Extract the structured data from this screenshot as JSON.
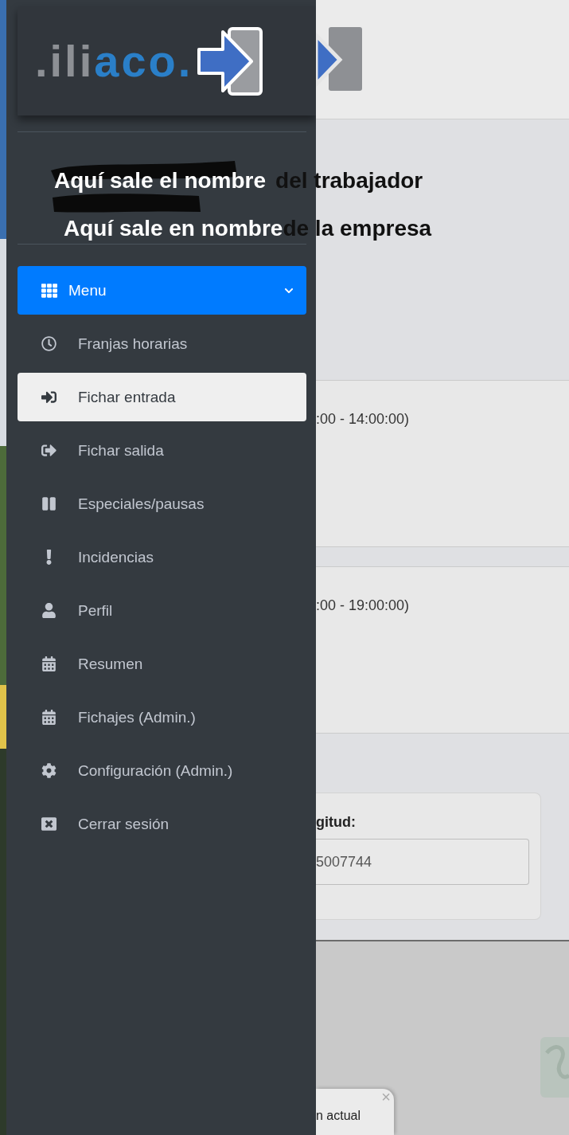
{
  "sidebar": {
    "logo": {
      "gray": ".ili",
      "blue": "aco."
    },
    "menu": {
      "label": "Menu",
      "expanded": true
    },
    "items": [
      {
        "label": "Franjas horarias",
        "selected": false
      },
      {
        "label": "Fichar entrada",
        "selected": true
      },
      {
        "label": "Fichar salida",
        "selected": false
      },
      {
        "label": "Especiales/pausas",
        "selected": false
      },
      {
        "label": "Incidencias",
        "selected": false
      },
      {
        "label": "Perfil",
        "selected": false
      },
      {
        "label": "Resumen",
        "selected": false
      },
      {
        "label": "Fichajes (Admin.)",
        "selected": false
      },
      {
        "label": "Configuración (Admin.)",
        "selected": false
      },
      {
        "label": "Cerrar sesión",
        "selected": false
      }
    ]
  },
  "annotations": [
    {
      "left": "Aquí sale el nombre",
      "right": "del trabajador"
    },
    {
      "left": "Aquí sale en nombre",
      "right": "de la empresa"
    }
  ],
  "slots": [
    {
      "time": ":00 - 14:00:00)"
    },
    {
      "time": ":00 - 19:00:00)"
    }
  ],
  "location": {
    "label": "gitud:",
    "value": "5007744"
  },
  "toast": {
    "text": "n actual",
    "close": "×"
  }
}
